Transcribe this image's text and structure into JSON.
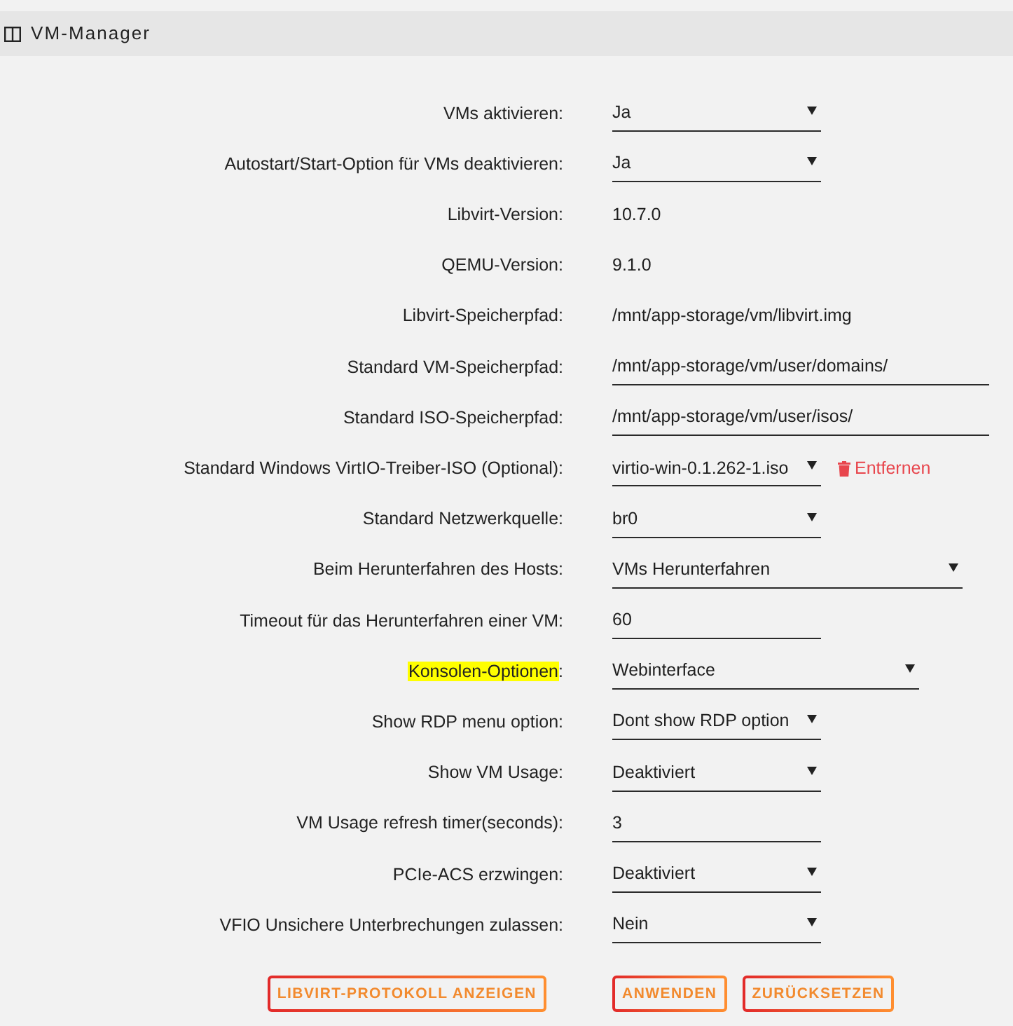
{
  "header": {
    "title": "VM-Manager"
  },
  "settings": [
    {
      "kind": "select",
      "label": "VMs aktivieren:",
      "value": "Ja"
    },
    {
      "kind": "select",
      "label": "Autostart/Start-Option für VMs deaktivieren:",
      "value": "Ja"
    },
    {
      "kind": "text",
      "label": "Libvirt-Version:",
      "value": "10.7.0"
    },
    {
      "kind": "text",
      "label": "QEMU-Version:",
      "value": "9.1.0"
    },
    {
      "kind": "text",
      "label": "Libvirt-Speicherpfad:",
      "value": "/mnt/app-storage/vm/libvirt.img"
    },
    {
      "kind": "input",
      "label": "Standard VM-Speicherpfad:",
      "value": "/mnt/app-storage/vm/user/domains/"
    },
    {
      "kind": "input",
      "label": "Standard ISO-Speicherpfad:",
      "value": "/mnt/app-storage/vm/user/isos/"
    },
    {
      "kind": "select",
      "label": "Standard Windows VirtIO-Treiber-ISO (Optional):",
      "value": "virtio-win-0.1.262-1.iso",
      "action": "Entfernen"
    },
    {
      "kind": "select",
      "label": "Standard Netzwerkquelle:",
      "value": "br0"
    },
    {
      "kind": "select",
      "label": "Beim Herunterfahren des Hosts:",
      "value": "VMs Herunterfahren"
    },
    {
      "kind": "input",
      "label": "Timeout für das Herunterfahren einer VM:",
      "value": "60"
    },
    {
      "kind": "select",
      "marked": "Konsolen-Optionen",
      "label": ":",
      "value": "Webinterface"
    },
    {
      "kind": "select",
      "label": "Show RDP menu option:",
      "value": "Dont show RDP option"
    },
    {
      "kind": "select",
      "label": "Show VM Usage:",
      "value": "Deaktiviert"
    },
    {
      "kind": "input",
      "label": "VM Usage refresh timer(seconds):",
      "value": "3"
    },
    {
      "kind": "select",
      "label": "PCIe-ACS erzwingen:",
      "value": "Deaktiviert"
    },
    {
      "kind": "select",
      "label": "VFIO Unsichere Unterbrechungen zulassen:",
      "value": "Nein"
    }
  ],
  "buttons": {
    "left": [
      "LIBVIRT-PROTOKOLL ANZEIGEN"
    ],
    "right": [
      "ANWENDEN",
      "ZURÜCKSETZEN"
    ]
  }
}
